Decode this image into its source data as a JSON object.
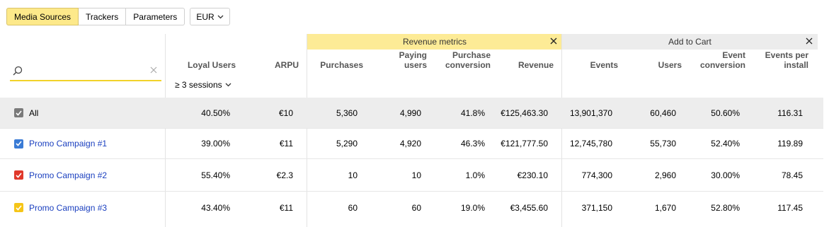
{
  "toolbar": {
    "tabs": [
      {
        "label": "Media Sources",
        "active": true
      },
      {
        "label": "Trackers",
        "active": false
      },
      {
        "label": "Parameters",
        "active": false
      }
    ],
    "currency": "EUR"
  },
  "search": {
    "value": "",
    "placeholder": ""
  },
  "groups": {
    "revenue": {
      "label": "Revenue metrics",
      "color": "#fdeb96"
    },
    "cart": {
      "label": "Add to Cart",
      "color": "#ececec"
    }
  },
  "columns": {
    "loyal_users": "Loyal Users",
    "loyal_filter": "≥ 3 sessions",
    "arpu": "ARPU",
    "purchases": "Purchases",
    "paying_users": [
      "Paying",
      "users"
    ],
    "purchase_conversion": [
      "Purchase",
      "conversion"
    ],
    "revenue": "Revenue",
    "events": "Events",
    "users": "Users",
    "event_conversion": [
      "Event",
      "conversion"
    ],
    "events_per_install": [
      "Events per",
      "install"
    ]
  },
  "rows": [
    {
      "name": "All",
      "checkbox_color": "#7a7a7a",
      "is_total": true,
      "values": [
        "40.50%",
        "€10",
        "5,360",
        "4,990",
        "41.8%",
        "€125,463.30",
        "13,901,370",
        "60,460",
        "50.60%",
        "116.31"
      ]
    },
    {
      "name": "Promo Campaign #1",
      "checkbox_color": "#3a7bd5",
      "is_total": false,
      "values": [
        "39.00%",
        "€11",
        "5,290",
        "4,920",
        "46.3%",
        "€121,777.50",
        "12,745,780",
        "55,730",
        "52.40%",
        "119.89"
      ]
    },
    {
      "name": "Promo Campaign #2",
      "checkbox_color": "#e0382b",
      "is_total": false,
      "values": [
        "55.40%",
        "€2.3",
        "10",
        "10",
        "1.0%",
        "€230.10",
        "774,300",
        "2,960",
        "30.00%",
        "78.45"
      ]
    },
    {
      "name": "Promo Campaign #3",
      "checkbox_color": "#f5c518",
      "is_total": false,
      "values": [
        "43.40%",
        "€11",
        "60",
        "60",
        "19.0%",
        "€3,455.60",
        "371,150",
        "1,670",
        "52.80%",
        "117.45"
      ]
    }
  ]
}
